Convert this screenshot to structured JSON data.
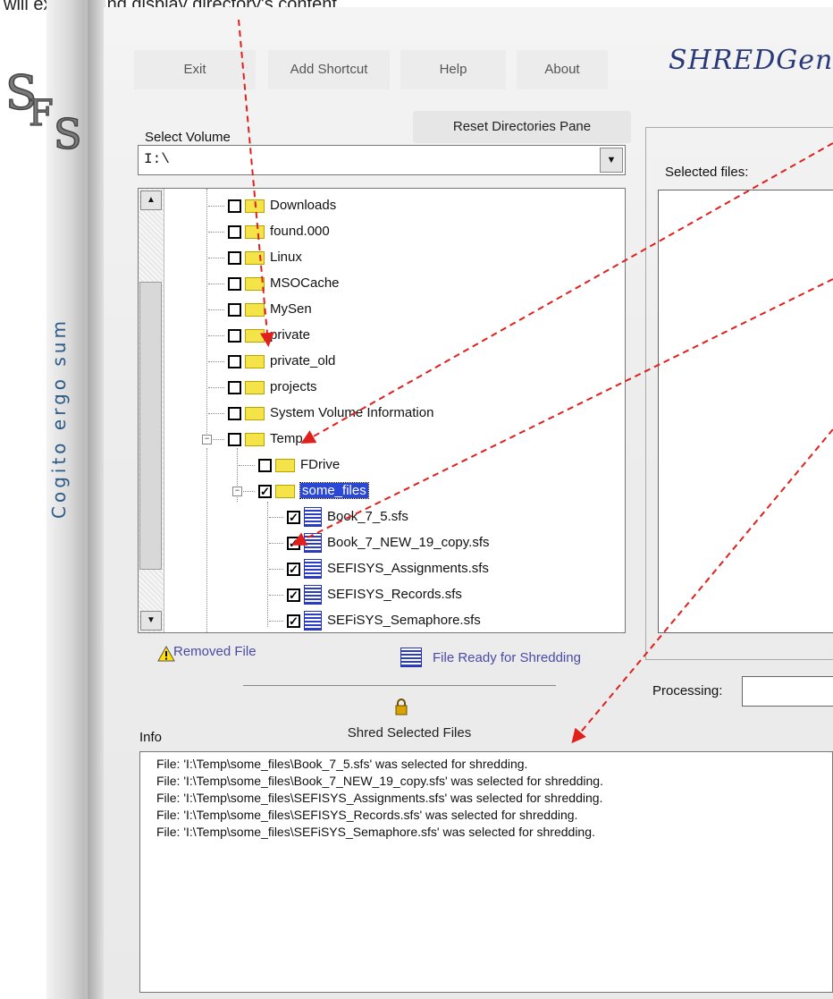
{
  "caption": "will expand and display directory's content.",
  "logo_text": "SFS",
  "motto": "Cogito ergo sum",
  "menu": {
    "exit": "Exit",
    "add_shortcut": "Add Shortcut",
    "help": "Help",
    "about": "About"
  },
  "app_title": "SHREDGen",
  "reset_button": "Reset Directories Pane",
  "select_volume_label": "Select Volume",
  "volume_value": "I:\\",
  "tree": {
    "folders": [
      "Downloads",
      "found.000",
      "Linux",
      "MSOCache",
      "MySen",
      "private",
      "private_old",
      "projects",
      "System Volume Information",
      "Temp"
    ],
    "temp_children": [
      "FDrive",
      "some_files"
    ],
    "files": [
      "Book_7_5.sfs",
      "Book_7_NEW_19_copy.sfs",
      "SEFISYS_Assignments.sfs",
      "SEFISYS_Records.sfs",
      "SEFiSYS_Semaphore.sfs"
    ]
  },
  "legend": {
    "removed": "Removed File",
    "ready": "File Ready for Shredding"
  },
  "shred_button": "Shred Selected Files",
  "info_label": "Info",
  "info_lines": [
    "File: 'I:\\Temp\\some_files\\Book_7_5.sfs' was selected for shredding.",
    "File: 'I:\\Temp\\some_files\\Book_7_NEW_19_copy.sfs' was selected for shredding.",
    "File: 'I:\\Temp\\some_files\\SEFISYS_Assignments.sfs' was selected for shredding.",
    "File: 'I:\\Temp\\some_files\\SEFISYS_Records.sfs' was selected for shredding.",
    "File: 'I:\\Temp\\some_files\\SEFiSYS_Semaphore.sfs' was selected for shredding."
  ],
  "selected_files_label": "Selected files:",
  "processing_label": "Processing:",
  "colors": {
    "accent": "#2a48d5",
    "annotation_arrow": "#e0201c",
    "motto": "#2c5a86"
  }
}
